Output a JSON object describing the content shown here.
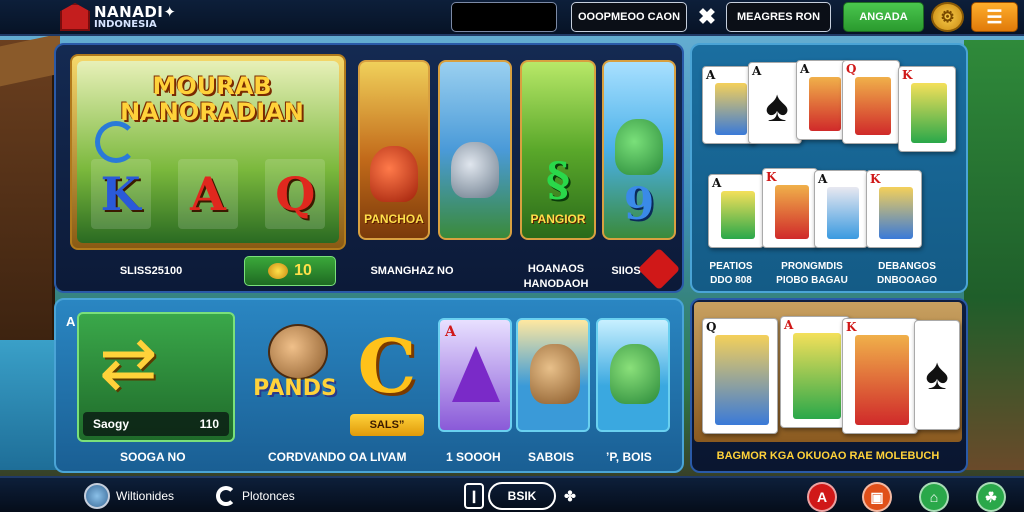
{
  "header": {
    "logo_title": "NANADI✦",
    "logo_subtitle": "INDONESIA",
    "search_value": "",
    "button_1": "OOOPMEOO CAON",
    "close_glyph": "✖",
    "button_2": "MEAGRES RON",
    "button_3": "ANGADA",
    "coin_glyph": "⚙",
    "menu_glyph": "☰"
  },
  "featured_slot": {
    "title": "MOURAB NANORADIAN",
    "symbols": [
      "K",
      "A",
      "Q"
    ],
    "caption": "SLISS25100",
    "coin_value": "10"
  },
  "slot_tiles": [
    {
      "label": "PANCHOA",
      "glyph": ""
    },
    {
      "label": "",
      "glyph": ""
    },
    {
      "label": "PANGIOR",
      "glyph": "§"
    },
    {
      "label": "",
      "glyph": "9"
    }
  ],
  "main_captions": {
    "middle": "SMANGHAZ NO",
    "right_line1": "HOANAOS",
    "right_line2": "HANODAOH",
    "far_right": "SIIOS"
  },
  "cards_panel_1": {
    "cards": [
      {
        "corner": "A",
        "suit": "spade"
      },
      {
        "corner": "A",
        "suit": "spade"
      },
      {
        "corner": "A",
        "suit": "spade"
      },
      {
        "corner": "Q",
        "suit": "heart"
      },
      {
        "corner": "K",
        "suit": "heart"
      },
      {
        "corner": "A",
        "suit": "spade"
      },
      {
        "corner": "K",
        "suit": "heart"
      },
      {
        "corner": "A",
        "suit": "spade"
      },
      {
        "corner": "K",
        "suit": "heart"
      }
    ],
    "captions": [
      {
        "line1": "PEATIOS",
        "line2": "DDO 808"
      },
      {
        "line1": "PRONGMDIS",
        "line2": "PIOBO BAGAU"
      },
      {
        "line1": "DEBANGOS",
        "line2": "DNBOOAGO"
      }
    ]
  },
  "bottom_panel": {
    "corner_letter": "A",
    "arrow_tile_left": "Saogy",
    "arrow_tile_right": "110",
    "pands_text": "PANDS",
    "c_glyph": "C",
    "sale_label": "SALS”",
    "captions": [
      "SOOGA NO",
      "CORDVANDO OA LIVAM",
      "1 SOOOH",
      "SABOIS",
      "’P, BOIS"
    ],
    "tile_corner": "A"
  },
  "cards_panel_2": {
    "cards": [
      {
        "corner": "Q",
        "suit": "spade"
      },
      {
        "corner": "A",
        "suit": "heart"
      },
      {
        "corner": "K",
        "suit": "heart"
      },
      {
        "corner": "",
        "suit": "spade"
      }
    ],
    "caption": "BAGMOR KGA OKUOAO RAE MOLEBUCH"
  },
  "footer": {
    "item_1": "Wiltionides",
    "item_2": "Plotonces",
    "mid_left": "❙",
    "mid_pill": "BSIK",
    "mid_right": "✤",
    "icon_1": "A",
    "icon_2": "▣",
    "icon_3": "⌂",
    "icon_4": "☘"
  },
  "colors": {
    "accent_green": "#2a9a2e",
    "accent_orange": "#e07a0a",
    "gold": "#ffd23a",
    "panel_blue": "#142a52"
  }
}
